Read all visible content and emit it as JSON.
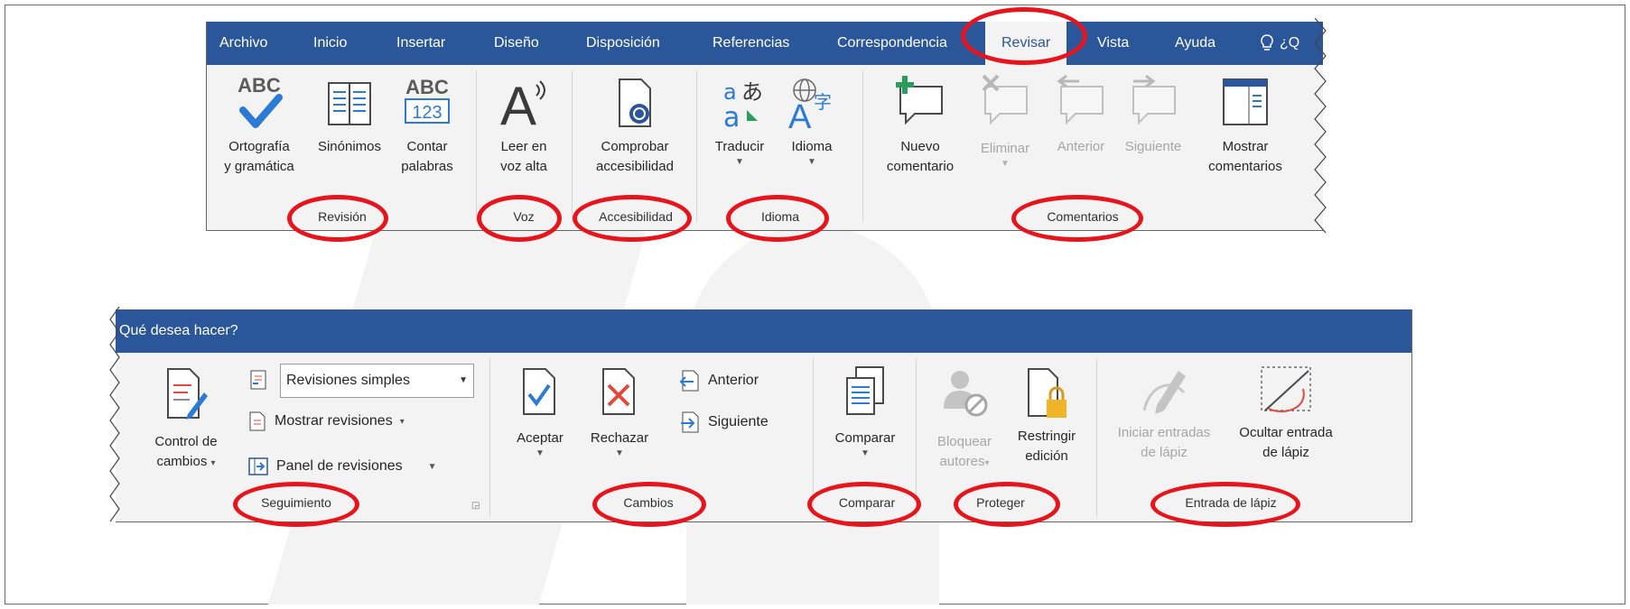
{
  "top_ribbon": {
    "tabs": [
      "Archivo",
      "Inicio",
      "Insertar",
      "Diseño",
      "Disposición",
      "Referencias",
      "Correspondencia",
      "Revisar",
      "Vista",
      "Ayuda"
    ],
    "tell_me_stub": "¿Q",
    "groups": {
      "revision": {
        "label": "Revisión",
        "spelling": [
          "Ortografía",
          "y gramática"
        ],
        "thesaurus": "Sinónimos",
        "word_count": [
          "Contar",
          "palabras"
        ],
        "icon_text_abc": "ABC",
        "icon_text_123": "123"
      },
      "voz": {
        "label": "Voz",
        "read_aloud": [
          "Leer en",
          "voz alta"
        ]
      },
      "accesibilidad": {
        "label": "Accesibilidad",
        "check": [
          "Comprobar",
          "accesibilidad"
        ]
      },
      "idioma": {
        "label": "Idioma",
        "translate": "Traducir",
        "language": "Idioma"
      },
      "comentarios": {
        "label": "Comentarios",
        "new_comment": [
          "Nuevo",
          "comentario"
        ],
        "delete": "Eliminar",
        "previous": "Anterior",
        "next": "Siguiente",
        "show_comments": [
          "Mostrar",
          "comentarios"
        ]
      }
    }
  },
  "bottom_ribbon": {
    "tell_me": "Qué desea hacer?",
    "groups": {
      "seguimiento": {
        "label": "Seguimiento",
        "track_changes": [
          "Control de",
          "cambios"
        ],
        "display_for_review": "Revisiones simples",
        "show_markup": "Mostrar revisiones",
        "reviewing_pane": "Panel de revisiones"
      },
      "cambios": {
        "label": "Cambios",
        "accept": "Aceptar",
        "reject": "Rechazar",
        "previous": "Anterior",
        "next": "Siguiente"
      },
      "comparar": {
        "label": "Comparar",
        "compare": "Comparar"
      },
      "proteger": {
        "label": "Proteger",
        "block_authors": [
          "Bloquear",
          "autores"
        ],
        "restrict_editing": [
          "Restringir",
          "edición"
        ]
      },
      "entrada_lapiz": {
        "label": "Entrada de lápiz",
        "start_inking": [
          "Iniciar entradas",
          "de lápiz"
        ],
        "hide_ink": [
          "Ocultar entrada",
          "de lápiz"
        ]
      }
    }
  },
  "colors": {
    "tab_bar": "#2b579a",
    "ribbon_bg": "#f3f3f3",
    "highlight": "#e8141c",
    "accent_blue": "#2b7bd6"
  }
}
